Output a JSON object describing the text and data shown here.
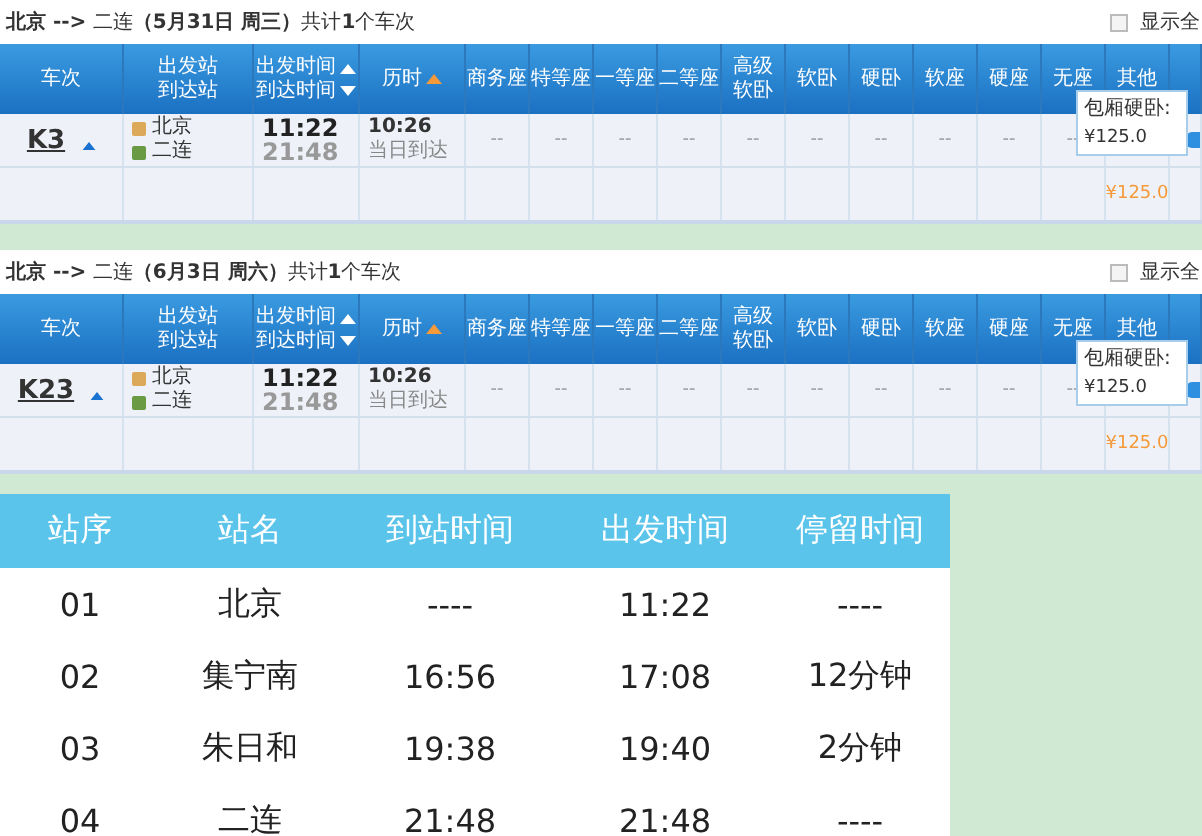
{
  "results": [
    {
      "title": "**北京 -->** 二连**（5月31日  周三）**共计**1**个车次",
      "show_all": {
        "label": "显示全",
        "checked": false
      },
      "columns": [
        {
          "lines": [
            "车次"
          ]
        },
        {
          "lines": [
            "出发站",
            "到达站"
          ]
        },
        {
          "lines": [
            "出发时间",
            "到达时间"
          ],
          "sort_up": true,
          "sort_down": true,
          "active": false
        },
        {
          "lines": [
            "历时"
          ],
          "sort_up": true,
          "sort_down": false,
          "active": true
        },
        {
          "lines": [
            "商务座"
          ]
        },
        {
          "lines": [
            "特等座"
          ]
        },
        {
          "lines": [
            "一等座"
          ]
        },
        {
          "lines": [
            "二等座"
          ]
        },
        {
          "lines": [
            "高级",
            "软卧"
          ]
        },
        {
          "lines": [
            "软卧"
          ]
        },
        {
          "lines": [
            "硬卧"
          ]
        },
        {
          "lines": [
            "软座"
          ]
        },
        {
          "lines": [
            "硬座"
          ]
        },
        {
          "lines": [
            "无座"
          ]
        },
        {
          "lines": [
            "其他"
          ]
        }
      ],
      "train": {
        "number": "K3",
        "from": "北京",
        "to": "二连",
        "depart": "11:22",
        "arrive": "21:48",
        "duration": "10:26",
        "note": "当日到达",
        "seats": [
          "--",
          "--",
          "--",
          "--",
          "--",
          "--",
          "--",
          "--",
          "--",
          "--"
        ],
        "price": "¥125.0"
      },
      "tooltip": {
        "label": "包厢硬卧:",
        "price": "¥125.0"
      }
    },
    {
      "title": "**北京 -->** 二连**（6月3日  周六）**共计**1**个车次",
      "show_all": {
        "label": "显示全",
        "checked": false
      },
      "columns": [
        {
          "lines": [
            "车次"
          ]
        },
        {
          "lines": [
            "出发站",
            "到达站"
          ]
        },
        {
          "lines": [
            "出发时间",
            "到达时间"
          ],
          "sort_up": true,
          "sort_down": true,
          "active": false
        },
        {
          "lines": [
            "历时"
          ],
          "sort_up": true,
          "sort_down": false,
          "active": true
        },
        {
          "lines": [
            "商务座"
          ]
        },
        {
          "lines": [
            "特等座"
          ]
        },
        {
          "lines": [
            "一等座"
          ]
        },
        {
          "lines": [
            "二等座"
          ]
        },
        {
          "lines": [
            "高级",
            "软卧"
          ]
        },
        {
          "lines": [
            "软卧"
          ]
        },
        {
          "lines": [
            "硬卧"
          ]
        },
        {
          "lines": [
            "软座"
          ]
        },
        {
          "lines": [
            "硬座"
          ]
        },
        {
          "lines": [
            "无座"
          ]
        },
        {
          "lines": [
            "其他"
          ]
        }
      ],
      "train": {
        "number": "K23",
        "from": "北京",
        "to": "二连",
        "depart": "11:22",
        "arrive": "21:48",
        "duration": "10:26",
        "note": "当日到达",
        "seats": [
          "--",
          "--",
          "--",
          "--",
          "--",
          "--",
          "--",
          "--",
          "--",
          "--"
        ],
        "price": "¥125.0"
      },
      "tooltip": {
        "label": "包厢硬卧:",
        "price": "¥125.0"
      }
    }
  ],
  "timetable": {
    "columns": [
      "站序",
      "站名",
      "到站时间",
      "出发时间",
      "停留时间"
    ],
    "rows": [
      [
        "01",
        "北京",
        "----",
        "11:22",
        "----"
      ],
      [
        "02",
        "集宁南",
        "16:56",
        "17:08",
        "12分钟"
      ],
      [
        "03",
        "朱日和",
        "19:38",
        "19:40",
        "2分钟"
      ],
      [
        "04",
        "二连",
        "21:48",
        "21:48",
        "----"
      ]
    ]
  }
}
